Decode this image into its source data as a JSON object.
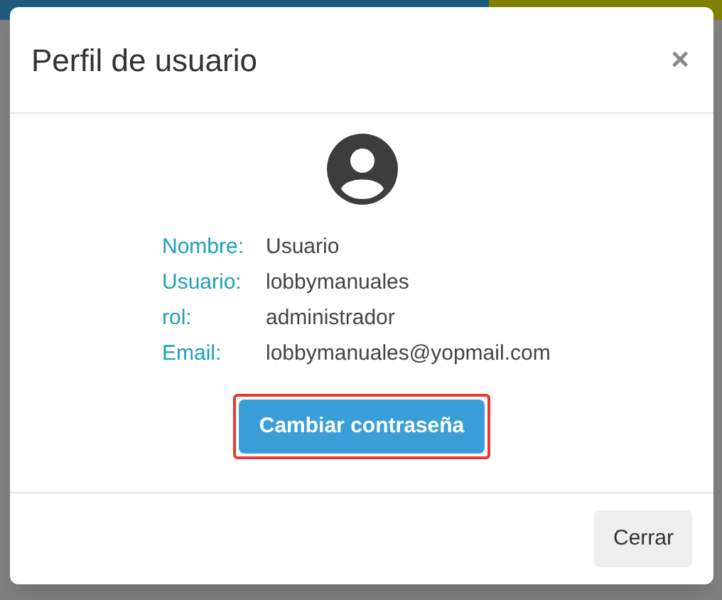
{
  "dialog": {
    "title": "Perfil de usuario",
    "close": "×",
    "fields": [
      {
        "label": "Nombre:",
        "value": "Usuario"
      },
      {
        "label": "Usuario:",
        "value": "lobbymanuales"
      },
      {
        "label": "rol:",
        "value": "administrador"
      },
      {
        "label": "Email:",
        "value": "lobbymanuales@yopmail.com"
      }
    ],
    "primary_button": {
      "label": "Cambiar contraseña",
      "highlighted": true
    },
    "footer_button": "Cerrar"
  }
}
